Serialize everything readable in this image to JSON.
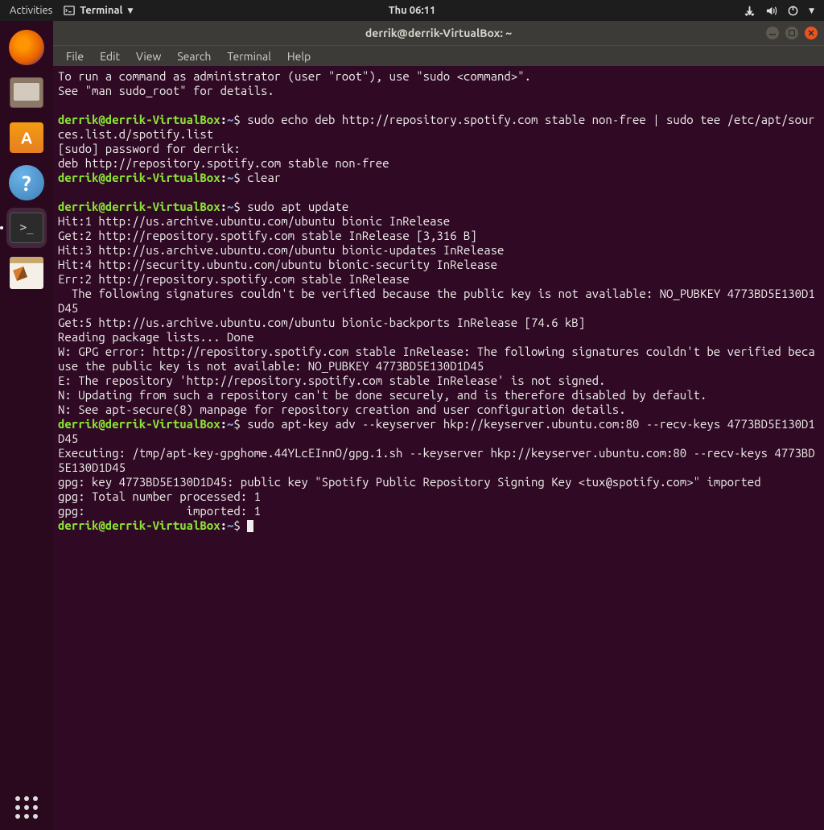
{
  "topbar": {
    "activities": "Activities",
    "app_label": "Terminal",
    "clock": "Thu 06:11"
  },
  "window": {
    "title": "derrik@derrik-VirtualBox: ~"
  },
  "menubar": [
    "File",
    "Edit",
    "View",
    "Search",
    "Terminal",
    "Help"
  ],
  "prompt": {
    "user_host": "derrik@derrik-VirtualBox",
    "colon": ":",
    "path": "~",
    "dollar": "$"
  },
  "lines": {
    "l1": "To run a command as administrator (user \"root\"), use \"sudo <command>\".",
    "l2": "See \"man sudo_root\" for details.",
    "cmd1": " sudo echo deb http://repository.spotify.com stable non-free | sudo tee /etc/apt/sources.list.d/spotify.list",
    "l3": "[sudo] password for derrik:",
    "l4": "deb http://repository.spotify.com stable non-free",
    "cmd2": " clear",
    "cmd3": " sudo apt update",
    "l5": "Hit:1 http://us.archive.ubuntu.com/ubuntu bionic InRelease",
    "l6": "Get:2 http://repository.spotify.com stable InRelease [3,316 B]",
    "l7": "Hit:3 http://us.archive.ubuntu.com/ubuntu bionic-updates InRelease",
    "l8": "Hit:4 http://security.ubuntu.com/ubuntu bionic-security InRelease",
    "l9": "Err:2 http://repository.spotify.com stable InRelease",
    "l10": "  The following signatures couldn't be verified because the public key is not available: NO_PUBKEY 4773BD5E130D1D45",
    "l11": "Get:5 http://us.archive.ubuntu.com/ubuntu bionic-backports InRelease [74.6 kB]",
    "l12": "Reading package lists... Done",
    "l13": "W: GPG error: http://repository.spotify.com stable InRelease: The following signatures couldn't be verified because the public key is not available: NO_PUBKEY 4773BD5E130D1D45",
    "l14": "E: The repository 'http://repository.spotify.com stable InRelease' is not signed.",
    "l15": "N: Updating from such a repository can't be done securely, and is therefore disabled by default.",
    "l16": "N: See apt-secure(8) manpage for repository creation and user configuration details.",
    "cmd4": " sudo apt-key adv --keyserver hkp://keyserver.ubuntu.com:80 --recv-keys 4773BD5E130D1D45",
    "l17": "Executing: /tmp/apt-key-gpghome.44YLcEInnO/gpg.1.sh --keyserver hkp://keyserver.ubuntu.com:80 --recv-keys 4773BD5E130D1D45",
    "l18": "gpg: key 4773BD5E130D1D45: public key \"Spotify Public Repository Signing Key <tux@spotify.com>\" imported",
    "l19": "gpg: Total number processed: 1",
    "l20": "gpg:               imported: 1"
  }
}
